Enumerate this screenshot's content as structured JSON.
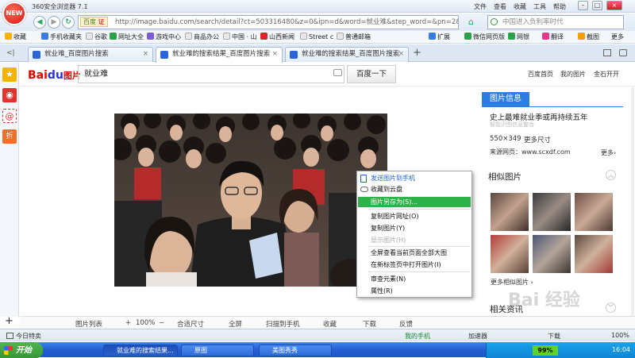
{
  "browser": {
    "app_title": "360安全浏览器 7.1",
    "logo_text": "NEW",
    "menus": [
      "文件",
      "查看",
      "收藏",
      "工具",
      "帮助"
    ],
    "window_buttons": [
      "–",
      "□",
      "×"
    ]
  },
  "address_bar": {
    "back": "◀",
    "forward": "▶",
    "refresh": "↻",
    "home": "⌂",
    "cert_label": "百度",
    "cert_badge": "证",
    "url": "http://image.baidu.com/search/detail?ct=503316480&z=0&ipn=d&word=就业难&step_word=&pn=2&spn",
    "search_placeholder": "中国进入负利率时代"
  },
  "favorites_bar": {
    "items": [
      "收藏",
      "手机收藏夹",
      "谷歌",
      "网址大全",
      "游戏中心",
      "商品办公",
      "中国 · 山",
      "山西新闻",
      "Street c",
      "普通邮箱"
    ],
    "tools": [
      "扩展",
      "微信网页版",
      "网银",
      "翻译",
      "截图",
      "更多"
    ]
  },
  "tabs": [
    {
      "label": "就业难_百度图片搜索",
      "close": "×"
    },
    {
      "label": "就业难的搜索结果_百度图片搜索",
      "close": "×"
    },
    {
      "label": "就业难的搜索结果_百度图片搜索",
      "close": "×"
    }
  ],
  "tab_add": "+",
  "baidu": {
    "logo_text": "Bai",
    "logo_paw": "du",
    "logo_suffix": "图片",
    "query": "就业难",
    "search_button": "百度一下",
    "top_links": [
      "百度首页",
      "我的图片",
      "金石开开"
    ]
  },
  "context_menu": [
    {
      "label": "发送图片到手机",
      "state": "blue"
    },
    {
      "label": "收藏到云盘",
      "state": "normal"
    },
    {
      "label": "图片另存为(S)...",
      "state": "highlight"
    },
    {
      "label": "复制图片网址(O)",
      "state": "normal"
    },
    {
      "label": "复制图片(Y)",
      "state": "normal"
    },
    {
      "label": "显示图片(H)",
      "state": "disabled"
    },
    {
      "label": "全屏查看当前页面全部大图",
      "state": "normal"
    },
    {
      "label": "在新标签页中打开图片(I)",
      "state": "normal"
    },
    {
      "label": "审查元素(N)",
      "state": "normal"
    },
    {
      "label": "属性(R)",
      "state": "normal"
    }
  ],
  "info_panel": {
    "title": "图片信息",
    "description": "史上最难就业季或再持续五年",
    "source_hint": "智能识图信息整合",
    "size": "550×349",
    "size_more": "更多尺寸",
    "source_label": "来源网页：www.scxdf.com",
    "more": "更多›",
    "related_title": "相似图片",
    "related_more": "更多相似图片 ›",
    "related_news": "相关资讯"
  },
  "bottom_toolbar": [
    "图片列表",
    "+",
    "100%",
    "−",
    "合适尺寸",
    "全屏",
    "扫描到手机",
    "收藏",
    "下载",
    "反馈"
  ],
  "status_bar": {
    "left": "今日特卖",
    "items": [
      "我的手机",
      "加速器",
      "下载",
      "100%"
    ]
  },
  "taskbar": {
    "start": "开始",
    "buttons": [
      "就业难的搜索结果...",
      "原图",
      "美图秀秀"
    ],
    "percent": "99%",
    "clock": "16:04"
  },
  "watermark": "Bai 经验",
  "colors": {
    "accent_blue": "#2a7de1",
    "highlight_green": "#2eb24a",
    "baidu_red": "#e10601"
  }
}
